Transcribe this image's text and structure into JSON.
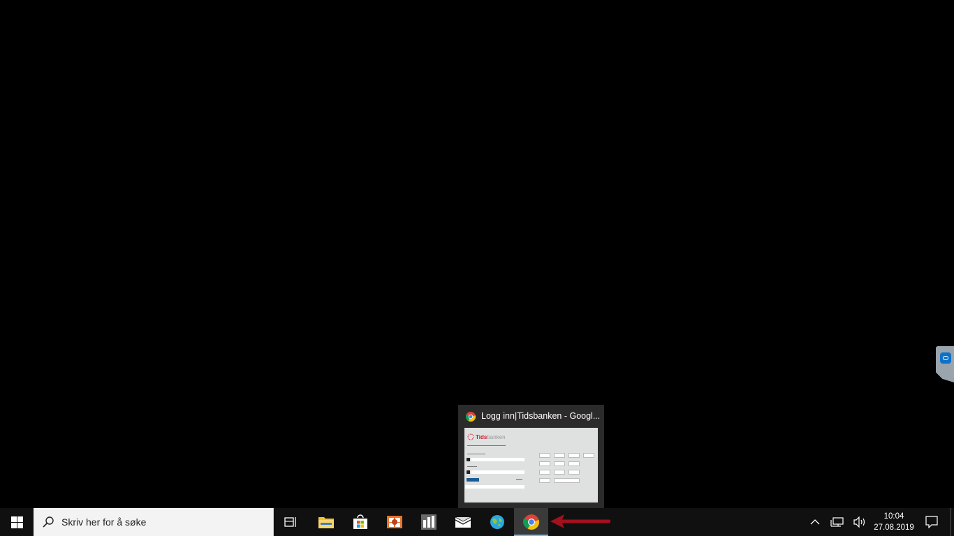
{
  "preview": {
    "title": "Logg inn|Tidsbanken - Googl...",
    "thumbnail": {
      "logo_brand": "Tids",
      "logo_rest": "banken"
    }
  },
  "search": {
    "placeholder": "Skriv her for å søke"
  },
  "taskbar": {
    "apps": [
      "task-view",
      "file-explorer",
      "microsoft-store",
      "office",
      "calculator-app",
      "mail",
      "globe-app",
      "google-chrome"
    ],
    "active_app": "google-chrome"
  },
  "clock": {
    "time": "10:04",
    "date": "27.08.2019"
  },
  "colors": {
    "taskbar": "#101010",
    "accent": "#76b9ed",
    "arrow": "#a3101e"
  }
}
